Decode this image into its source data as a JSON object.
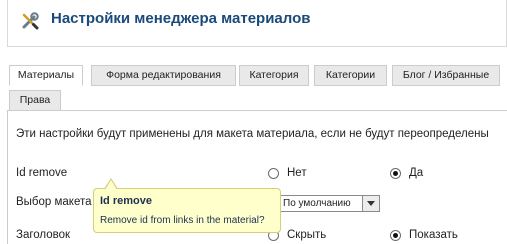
{
  "header": {
    "title": "Настройки менеджера материалов",
    "icon": "wrench-screwdriver-icon"
  },
  "tabs": [
    {
      "label": "Материалы",
      "active": true
    },
    {
      "label": "Форма редактирования",
      "active": false
    },
    {
      "label": "Категория",
      "active": false
    },
    {
      "label": "Категории",
      "active": false
    },
    {
      "label": "Блог / Избранные",
      "active": false
    },
    {
      "label": "Права",
      "active": false
    }
  ],
  "panel": {
    "description": "Эти настройки будут применены для макета материала, если не будут переопределены",
    "rows": [
      {
        "label": "Id remove",
        "options": [
          "Нет",
          "Да"
        ],
        "selected": "Да"
      },
      {
        "label": "Выбор макета",
        "select_value": "По умолчанию"
      },
      {
        "label": "Заголовок",
        "options": [
          "Скрыть",
          "Показать"
        ],
        "selected": "Показать"
      }
    ]
  },
  "tooltip": {
    "title": "Id remove",
    "text": "Remove id from links in the material?"
  }
}
